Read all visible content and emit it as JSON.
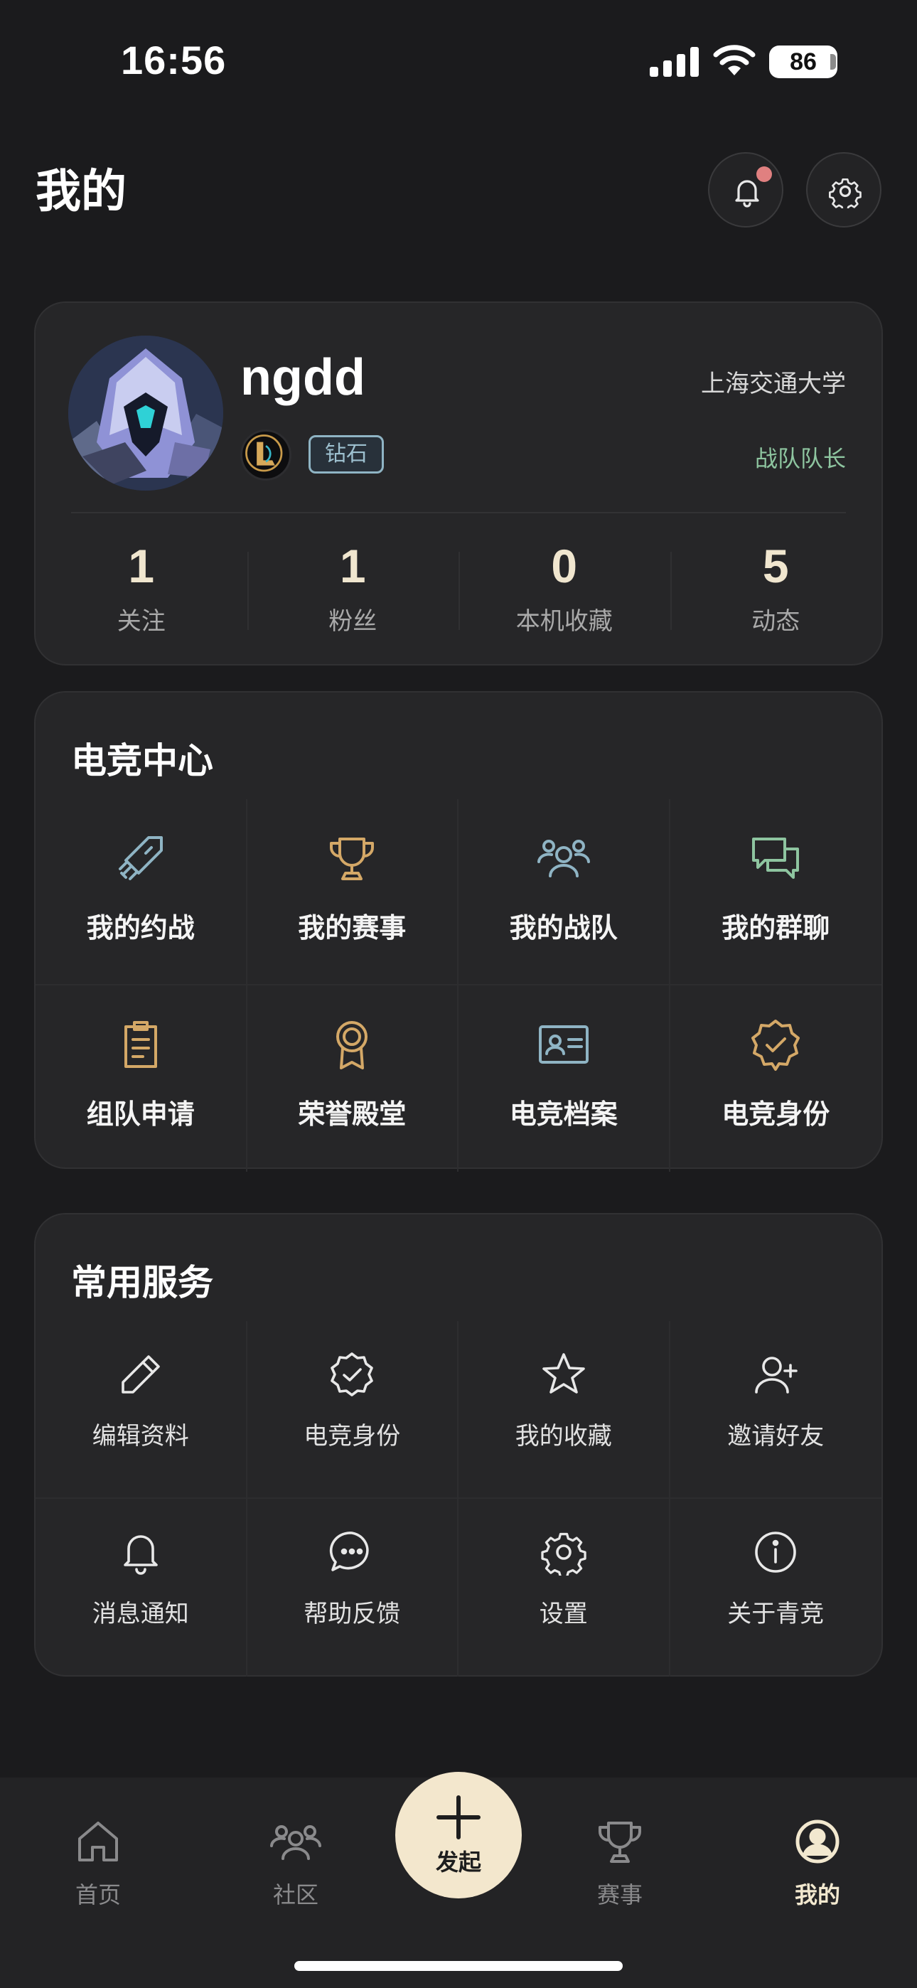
{
  "status_bar": {
    "time": "16:56",
    "battery": "86"
  },
  "header": {
    "title": "我的"
  },
  "profile": {
    "username": "ngdd",
    "rank": "钻石",
    "school": "上海交通大学",
    "role": "战队队长",
    "stats": [
      {
        "value": "1",
        "label": "关注"
      },
      {
        "value": "1",
        "label": "粉丝"
      },
      {
        "value": "0",
        "label": "本机收藏"
      },
      {
        "value": "5",
        "label": "动态"
      }
    ]
  },
  "esports": {
    "title": "电竞中心",
    "items": [
      {
        "label": "我的约战",
        "icon": "sword-icon",
        "color": "#8fb4c4"
      },
      {
        "label": "我的赛事",
        "icon": "trophy-icon",
        "color": "#d4a867"
      },
      {
        "label": "我的战队",
        "icon": "team-icon",
        "color": "#8fb4c4"
      },
      {
        "label": "我的群聊",
        "icon": "chat-icon",
        "color": "#8ec5a0"
      },
      {
        "label": "组队申请",
        "icon": "clipboard-icon",
        "color": "#d4a867"
      },
      {
        "label": "荣誉殿堂",
        "icon": "medal-icon",
        "color": "#d4a867"
      },
      {
        "label": "电竞档案",
        "icon": "id-card-icon",
        "color": "#8fb4c4"
      },
      {
        "label": "电竞身份",
        "icon": "verified-badge-icon",
        "color": "#d4a867"
      }
    ]
  },
  "services": {
    "title": "常用服务",
    "items": [
      {
        "label": "编辑资料",
        "icon": "pencil-icon"
      },
      {
        "label": "电竞身份",
        "icon": "verified-badge-icon"
      },
      {
        "label": "我的收藏",
        "icon": "star-icon"
      },
      {
        "label": "邀请好友",
        "icon": "add-user-icon"
      },
      {
        "label": "消息通知",
        "icon": "bell-icon"
      },
      {
        "label": "帮助反馈",
        "icon": "chat-bubble-icon"
      },
      {
        "label": "设置",
        "icon": "gear-icon"
      },
      {
        "label": "关于青竞",
        "icon": "info-icon"
      }
    ]
  },
  "tabs": [
    {
      "label": "首页",
      "icon": "home-icon"
    },
    {
      "label": "社区",
      "icon": "community-icon"
    },
    {
      "label": "赛事",
      "icon": "trophy-icon"
    },
    {
      "label": "我的",
      "icon": "profile-icon"
    }
  ],
  "fab": {
    "label": "发起"
  },
  "colors": {
    "accent": "#f3e7cd",
    "background": "#1b1b1d",
    "card": "#262628",
    "role_green": "#8ec5a0"
  }
}
